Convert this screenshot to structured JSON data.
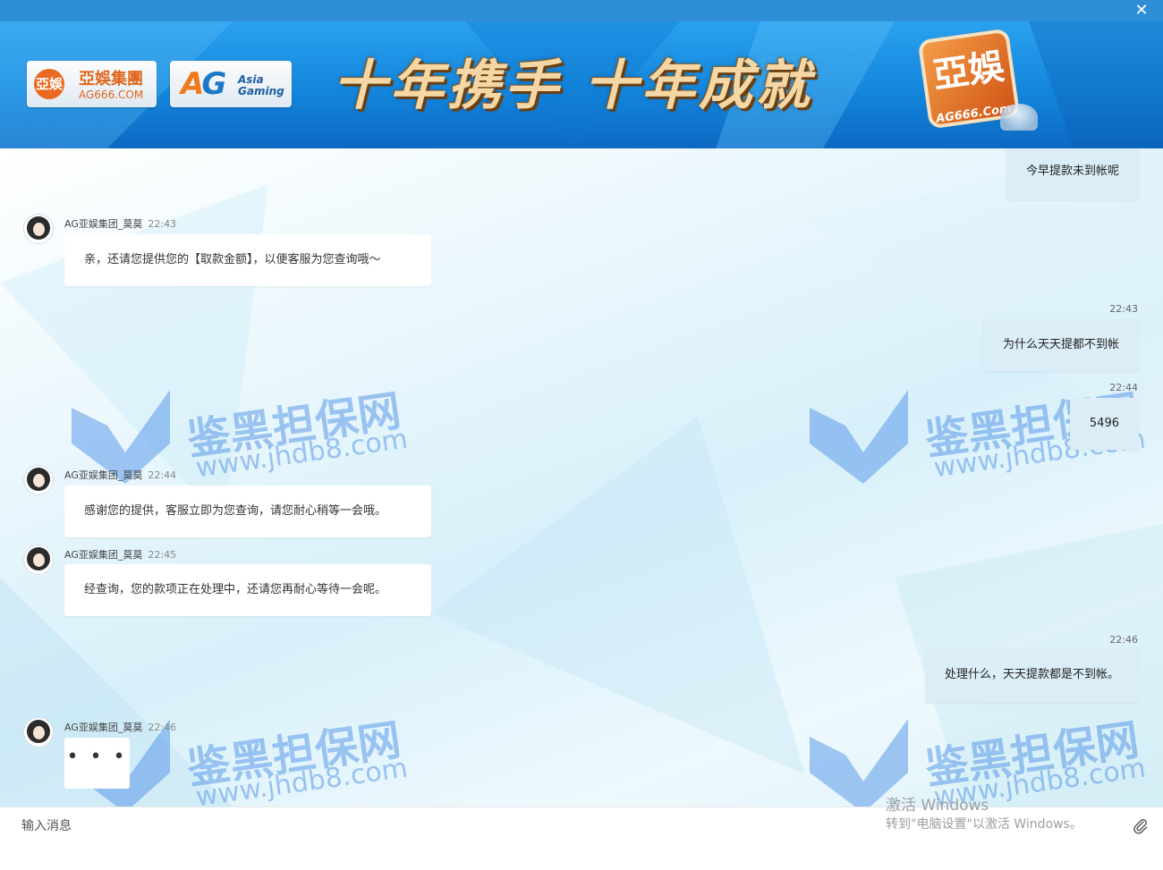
{
  "window": {
    "close_icon": "✕"
  },
  "banner": {
    "logo1": {
      "badge": "亞娛",
      "cn": "亞娛集團",
      "en": "AG666.COM"
    },
    "logo2": {
      "mark_a": "A",
      "mark_g": "G",
      "line1": "Asia",
      "line2": "Gaming"
    },
    "slogan": "十年携手 十年成就",
    "seal_text": "亞娛",
    "seal_sub": "AG666.Com"
  },
  "watermark": {
    "cn": "鉴黑担保网",
    "url": "www.jhdb8.com"
  },
  "chat": {
    "agent_name": "AG亚娱集团_莫莫",
    "typing": "• • •",
    "messages": [
      {
        "side": "right",
        "time": "",
        "text": "今早提款未到帐呢"
      },
      {
        "side": "left",
        "time": "22:43",
        "text": "亲，还请您提供您的【取款金额】，以便客服为您查询哦～"
      },
      {
        "side": "right",
        "time": "22:43",
        "text": "为什么天天提都不到帐"
      },
      {
        "side": "right",
        "time": "22:44",
        "text": "5496"
      },
      {
        "side": "left",
        "time": "22:44",
        "text": "感谢您的提供，客服立即为您查询，请您耐心稍等一会哦。"
      },
      {
        "side": "left",
        "time": "22:45",
        "text": "经查询，您的款项正在处理中，还请您再耐心等待一会呢。"
      },
      {
        "side": "right",
        "time": "22:46",
        "text": "处理什么，天天提款都是不到帐。"
      },
      {
        "side": "left",
        "time": "22:46",
        "text": ""
      }
    ]
  },
  "input": {
    "placeholder": "输入消息"
  },
  "os_notice": {
    "line1": "激活 Windows",
    "line2": "转到\"电脑设置\"以激活 Windows。"
  }
}
